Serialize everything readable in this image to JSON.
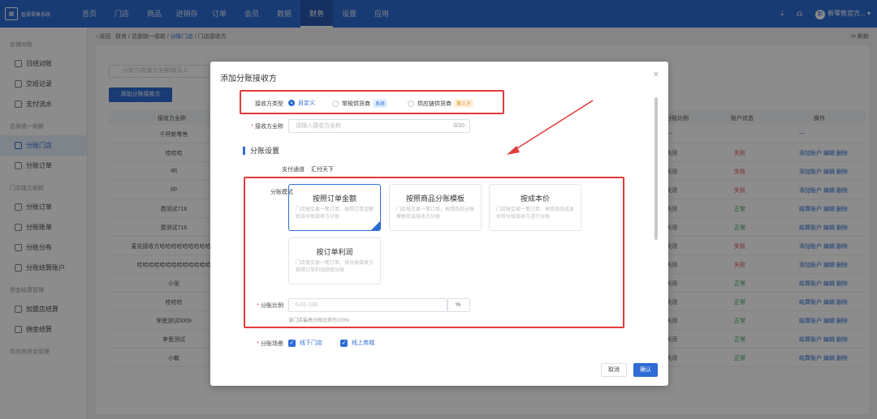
{
  "topbar": {
    "brand": "智慧零售系统",
    "nav": [
      "首页",
      "门店",
      "商品",
      "进销存",
      "订单",
      "会员",
      "数据",
      "财务",
      "设置",
      "应用"
    ],
    "active_nav": "财务",
    "user": "新零售官方...",
    "user_initial": "新"
  },
  "sidebar": {
    "groups": [
      {
        "title": "店铺对账",
        "items": [
          "日结对账",
          "交班记录",
          "支付流水"
        ]
      },
      {
        "title": "总部统一收款",
        "items": [
          "分账门店",
          "分账订单"
        ]
      },
      {
        "title": "门店独立收款",
        "items": [
          "分账订单",
          "分账账单",
          "分账分布",
          "分账结算账户"
        ]
      },
      {
        "title": "资金结算管理",
        "items": [
          "加盟店结算",
          "佣金结算"
        ]
      },
      {
        "title": "供应商资金管理",
        "items": []
      }
    ],
    "active_item": "分账门店"
  },
  "breadcrumb": {
    "back": "返回",
    "path": "财务 / 总部统一收款 / ",
    "current": "分账门店",
    "tail": " / 门店接收方",
    "refresh": "刷新"
  },
  "page": {
    "search_placeholder": "分账方/收款方全称/联系人",
    "add_button": "添加分账接收方",
    "columns": [
      "接收方全称",
      "分账比例",
      "账户状态",
      "操作"
    ],
    "rows": [
      {
        "name": "千杯新零售",
        "status": "—",
        "state": "",
        "actions": "—"
      },
      {
        "name": "哇哈哈",
        "status": "关闭",
        "state": "失败",
        "actions": "添加账户 编辑 删除"
      },
      {
        "name": "qq",
        "status": "关闭",
        "state": "失败",
        "actions": "添加账户 编辑 删除"
      },
      {
        "name": "pp",
        "status": "关闭",
        "state": "失败",
        "actions": "添加账户 编辑 删除"
      },
      {
        "name": "费测试716",
        "status": "关闭",
        "state": "正常",
        "actions": "结算账户 编辑 删除"
      },
      {
        "name": "费测试716",
        "status": "关闭",
        "state": "正常",
        "actions": "结算账户 编辑 删除"
      },
      {
        "name": "麦花接收方哈哈哈哈哈哈哈哈哈哈",
        "status": "关闭",
        "state": "失败",
        "actions": "添加账户 编辑 删除"
      },
      {
        "name": "哈哈哈哈哈哈哈哈哈哈哈哈哈",
        "status": "关闭",
        "state": "失败",
        "actions": "添加账户 编辑 删除"
      },
      {
        "name": "小张",
        "status": "关闭",
        "state": "正常",
        "actions": "结算账户 编辑 删除"
      },
      {
        "name": "哇哈哈",
        "status": "关闭",
        "state": "正常",
        "actions": "结算账户 编辑 删除"
      },
      {
        "name": "李思测试0009",
        "status": "关闭",
        "state": "正常",
        "actions": "结算账户 编辑 删除"
      },
      {
        "name": "李思测试",
        "status": "关闭",
        "state": "正常",
        "actions": "结算账户 编辑 删除"
      },
      {
        "name": "小敏",
        "status": "关闭",
        "state": "正常",
        "actions": "结算账户 编辑 删除"
      }
    ]
  },
  "modal": {
    "title": "添加分账接收方",
    "receiver_type_label": "接收方类型",
    "types": [
      {
        "label": "自定义",
        "tag": ""
      },
      {
        "label": "常规供货商",
        "tag": "系统"
      },
      {
        "label": "供应链供货商",
        "tag": "第三方"
      }
    ],
    "fullname_label": "接收方全称",
    "fullname_placeholder": "请输入接收方全称",
    "fullname_count": "0/20",
    "section_title": "分账设置",
    "channel_label": "支付通道",
    "channel_value": "汇付天下",
    "mode_label": "分账模式",
    "modes": [
      {
        "title": "按照订单金额",
        "desc": "门店每交易一笔订单，按照订单金额给该分账接收方分账"
      },
      {
        "title": "按照商品分账模板",
        "desc": "门店每交易一笔订单，按照商品分账模板给该接收方分账"
      },
      {
        "title": "按成本价",
        "desc": "门店每交易一笔订单，按照商品成本价给分账接收方进行分账"
      },
      {
        "title": "按订单利润",
        "desc": "门店每交易一笔订单，该分账接收方按照订单利润获取分账"
      }
    ],
    "ratio_label": "分账比例",
    "ratio_placeholder": "0.01-100",
    "ratio_unit": "%",
    "ratio_hint": "该门店最高分账比例为100%",
    "scene_label": "分账场景",
    "scenes": [
      "线下门店",
      "线上商城"
    ],
    "cancel": "取消",
    "confirm": "确认"
  }
}
